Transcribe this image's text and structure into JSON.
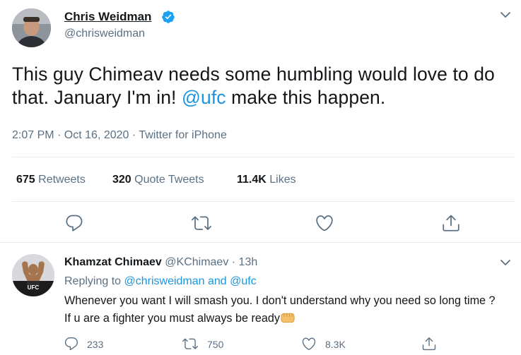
{
  "tweet": {
    "author_name": "Chris Weidman",
    "author_handle": "@chrisweidman",
    "text_before": "This guy Chimeav needs some humbling would love to do that. January I'm in! ",
    "mention": "@ufc",
    "text_after": " make this happen.",
    "timestamp": "2:07 PM · Oct 16, 2020 · Twitter for iPhone",
    "retweets_count": "675",
    "retweets_label": "Retweets",
    "quote_count": "320",
    "quote_label": "Quote Tweets",
    "likes_count": "11.4K",
    "likes_label": "Likes"
  },
  "reply": {
    "author_name": "Khamzat Chimaev",
    "author_handle": "@KChimaev",
    "time": "· 13h",
    "replying_prefix": "Replying to ",
    "replying_users": "@chrisweidman and @ufc",
    "avatar_badge": "UFC",
    "text": "Whenever you want I will smash you. I don't understand why you need so long time ? If u are a fighter you must always be ready",
    "reply_count": "233",
    "retweet_count": "750",
    "like_count": "8.3K"
  },
  "colors": {
    "accent": "#1b95e0",
    "secondary_text": "#5b7083",
    "divider": "#e6ecf0",
    "verified_badge": "#1da1f2"
  },
  "icons": [
    "verified-badge-icon",
    "chevron-down-icon",
    "reply-icon",
    "retweet-icon",
    "like-icon",
    "share-icon",
    "fist-emoji-icon"
  ]
}
